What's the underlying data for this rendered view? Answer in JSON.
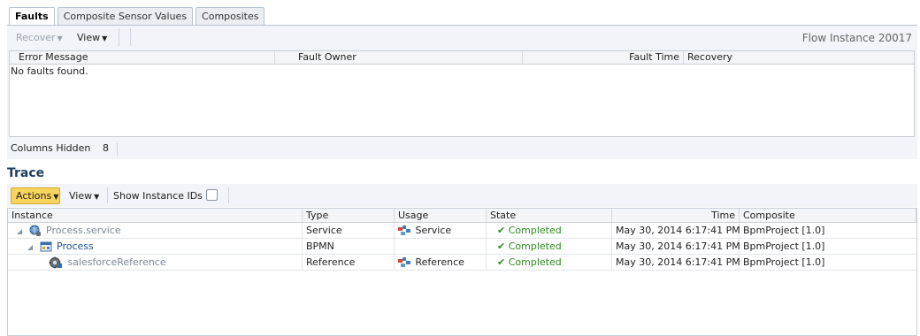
{
  "tabs": [
    {
      "label": "Faults",
      "active": true
    },
    {
      "label": "Composite Sensor Values",
      "active": false
    },
    {
      "label": "Composites",
      "active": false
    }
  ],
  "faults": {
    "toolbar": {
      "recover_label": "Recover",
      "view_label": "View"
    },
    "flow_instance_label": "Flow Instance 20017",
    "columns": [
      "Error Message",
      "Fault Owner",
      "Fault Time",
      "Recovery"
    ],
    "empty_message": "No faults found.",
    "footer": {
      "columns_hidden_label": "Columns Hidden",
      "columns_hidden_count": "8"
    }
  },
  "trace": {
    "title": "Trace",
    "toolbar": {
      "actions_label": "Actions",
      "view_label": "View",
      "show_ids_label": "Show Instance IDs",
      "show_ids_checked": false
    },
    "columns": [
      "Instance",
      "Type",
      "Usage",
      "State",
      "Time",
      "Composite"
    ],
    "rows": [
      {
        "instance": "Process.service",
        "type": "Service",
        "usage": "Service",
        "state": "Completed",
        "time": "May 30, 2014 6:17:41 PM",
        "composite": "BpmProject [1.0]"
      },
      {
        "instance": "Process",
        "type": "BPMN",
        "usage": "",
        "state": "Completed",
        "time": "May 30, 2014 6:17:41 PM",
        "composite": "BpmProject [1.0]"
      },
      {
        "instance": "salesforceReference",
        "type": "Reference",
        "usage": "Reference",
        "state": "Completed",
        "time": "May 30, 2014 6:17:41 PM",
        "composite": "BpmProject [1.0]"
      }
    ]
  },
  "colors": {
    "accent_button": "#f7d45c",
    "completed_green": "#2e8b1e",
    "title_blue": "#1f3e5c"
  }
}
